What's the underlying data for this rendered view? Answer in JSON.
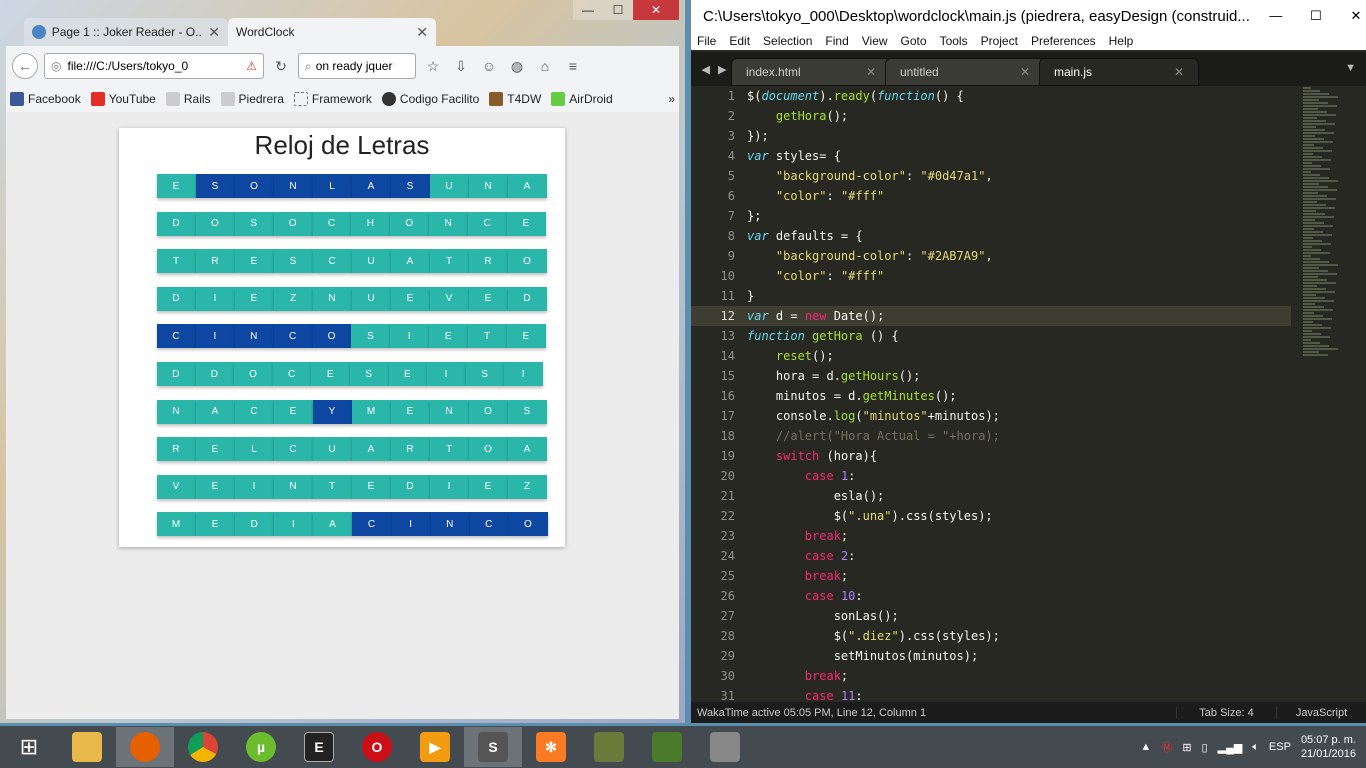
{
  "firefox": {
    "tabs": [
      {
        "label": "Page 1 :: Joker Reader - O..."
      },
      {
        "label": "WordClock"
      }
    ],
    "url": "file:///C:/Users/tokyo_0",
    "search": "on ready jquer",
    "bookmarks": [
      "Facebook",
      "YouTube",
      "Rails",
      "Piedrera",
      "Framework",
      "Codigo Facilito",
      "T4DW",
      "AirDroid"
    ],
    "bookmarks_more": "»",
    "page": {
      "title": "Reloj de Letras",
      "colors": {
        "default": "#2AB7A9",
        "active": "#0d47a1"
      },
      "grid": [
        {
          "letters": [
            "E",
            "S",
            "O",
            "N",
            "L",
            "A",
            "S",
            "U",
            "N",
            "A"
          ],
          "active": [
            false,
            true,
            true,
            true,
            true,
            true,
            true,
            false,
            false,
            false
          ]
        },
        {
          "letters": [
            "D",
            "O",
            "S",
            "O",
            "C",
            "H",
            "O",
            "N",
            "C",
            "E"
          ],
          "active": [
            false,
            false,
            false,
            false,
            false,
            false,
            false,
            false,
            false,
            false
          ]
        },
        {
          "letters": [
            "T",
            "R",
            "E",
            "S",
            "C",
            "U",
            "A",
            "T",
            "R",
            "O"
          ],
          "active": [
            false,
            false,
            false,
            false,
            false,
            false,
            false,
            false,
            false,
            false
          ]
        },
        {
          "letters": [
            "D",
            "I",
            "E",
            "Z",
            "N",
            "U",
            "E",
            "V",
            "E",
            "D"
          ],
          "active": [
            false,
            false,
            false,
            false,
            false,
            false,
            false,
            false,
            false,
            false
          ]
        },
        {
          "letters": [
            "C",
            "I",
            "N",
            "C",
            "O",
            "S",
            "I",
            "E",
            "T",
            "E"
          ],
          "active": [
            true,
            true,
            true,
            true,
            true,
            false,
            false,
            false,
            false,
            false
          ]
        },
        {
          "letters": [
            "D",
            "D",
            "O",
            "C",
            "E",
            "S",
            "E",
            "I",
            "S",
            "I"
          ],
          "active": [
            false,
            false,
            false,
            false,
            false,
            false,
            false,
            false,
            false,
            false
          ]
        },
        {
          "letters": [
            "N",
            "A",
            "C",
            "E",
            "Y",
            "M",
            "E",
            "N",
            "O",
            "S"
          ],
          "active": [
            false,
            false,
            false,
            false,
            true,
            false,
            false,
            false,
            false,
            false
          ]
        },
        {
          "letters": [
            "R",
            "E",
            "L",
            "C",
            "U",
            "A",
            "R",
            "T",
            "O",
            "A"
          ],
          "active": [
            false,
            false,
            false,
            false,
            false,
            false,
            false,
            false,
            false,
            false
          ]
        },
        {
          "letters": [
            "V",
            "E",
            "I",
            "N",
            "T",
            "E",
            "D",
            "I",
            "E",
            "Z"
          ],
          "active": [
            false,
            false,
            false,
            false,
            false,
            false,
            false,
            false,
            false,
            false
          ]
        },
        {
          "letters": [
            "M",
            "E",
            "D",
            "I",
            "A",
            "C",
            "I",
            "N",
            "C",
            "O"
          ],
          "active": [
            false,
            false,
            false,
            false,
            false,
            true,
            true,
            true,
            true,
            true
          ]
        }
      ]
    }
  },
  "sublime": {
    "title": "C:\\Users\\tokyo_000\\Desktop\\wordclock\\main.js (piedrera, easyDesign (construid...",
    "menu": [
      "File",
      "Edit",
      "Selection",
      "Find",
      "View",
      "Goto",
      "Tools",
      "Project",
      "Preferences",
      "Help"
    ],
    "tabs": [
      {
        "label": "index.html"
      },
      {
        "label": "untitled"
      },
      {
        "label": "main.js"
      }
    ],
    "line_numbers": [
      "1",
      "2",
      "3",
      "4",
      "5",
      "6",
      "7",
      "8",
      "9",
      "10",
      "11",
      "12",
      "13",
      "14",
      "15",
      "16",
      "17",
      "18",
      "19",
      "20",
      "21",
      "22",
      "23",
      "24",
      "25",
      "26",
      "27",
      "28",
      "29",
      "30",
      "31"
    ],
    "code": [
      "$(document).ready(function() {",
      "    getHora();",
      "});",
      "var styles= {",
      "    \"background-color\": \"#0d47a1\",",
      "    \"color\": \"#fff\"",
      "};",
      "var defaults = {",
      "    \"background-color\": \"#2AB7A9\",",
      "    \"color\": \"#fff\"",
      "}",
      "var d = new Date();",
      "function getHora () {",
      "    reset();",
      "    hora = d.getHours();",
      "    minutos = d.getMinutes();",
      "    console.log(\"minutos\"+minutos);",
      "    //alert(\"Hora Actual = \"+hora);",
      "    switch (hora){",
      "        case 1:",
      "            esla();",
      "            $(\".una\").css(styles);",
      "        break;",
      "        case 2:",
      "        break;",
      "        case 10:",
      "            sonLas();",
      "            $(\".diez\").css(styles);",
      "            setMinutos(minutos);",
      "        break;",
      "        case 11:"
    ],
    "status": {
      "left": "WakaTime active 05:05 PM, Line 12, Column 1",
      "tabsize": "Tab Size: 4",
      "syntax": "JavaScript"
    }
  },
  "taskbar": {
    "lang": "ESP",
    "time": "05:07 p. m.",
    "date": "21/01/2016"
  }
}
